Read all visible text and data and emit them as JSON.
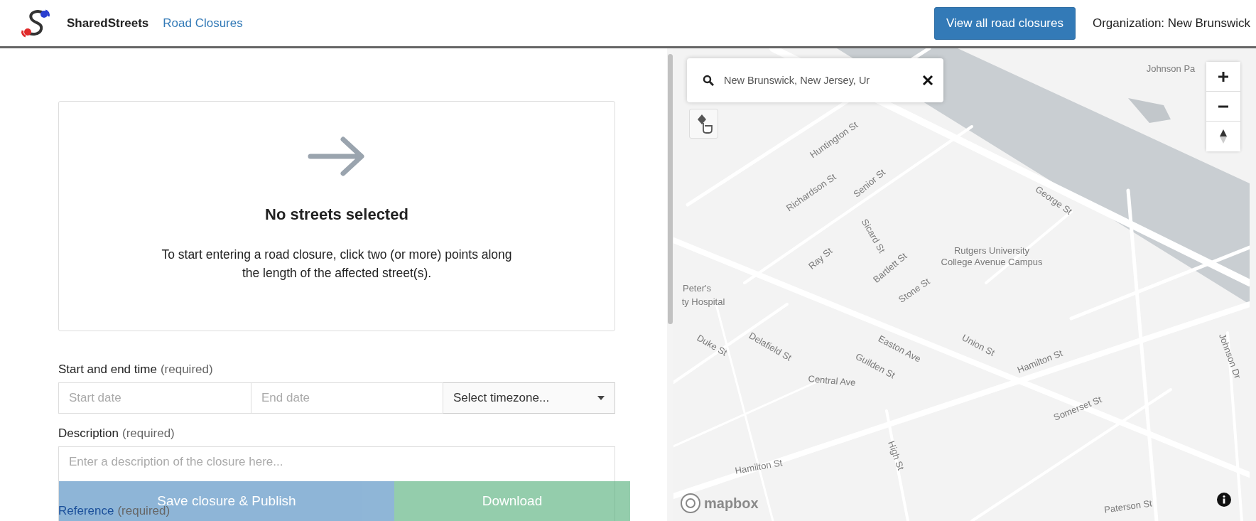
{
  "header": {
    "brand": "SharedStreets",
    "nav_link": "Road Closures",
    "view_all_button": "View all road closures",
    "organization": "Organization: New Brunswick"
  },
  "selection_card": {
    "title": "No streets selected",
    "message": "To start entering a road closure, click two (or more) points along the length of the affected street(s)."
  },
  "form": {
    "time": {
      "label": "Start and end time",
      "required_note": "(required)",
      "start_placeholder": "Start date",
      "end_placeholder": "End date",
      "timezone": "Select timezone..."
    },
    "description": {
      "label": "Description",
      "required_note": "(required)",
      "placeholder": "Enter a description of the closure here..."
    },
    "reference": {
      "label": "Reference",
      "required_note": "(required)"
    }
  },
  "actions": [
    {
      "kind": "publish",
      "label": "Save closure & Publish",
      "disabled": true
    },
    {
      "kind": "download",
      "label": "Download",
      "disabled": true
    }
  ],
  "map": {
    "search": {
      "value": "New Brunswick, New Jersey, Ur"
    },
    "labels": [
      {
        "text": "Huntington St"
      },
      {
        "text": "Richardson St"
      },
      {
        "text": "Senior St"
      },
      {
        "text": "Sicard St"
      },
      {
        "text": "Ray St"
      },
      {
        "text": "Bartlett St"
      },
      {
        "text": "Stone St"
      },
      {
        "text": "George St"
      },
      {
        "text": "Rutgers University College Avenue Campus"
      },
      {
        "text": "Johnson Pa"
      },
      {
        "text": "Peter's"
      },
      {
        "text": "ty Hospital"
      },
      {
        "text": "Duke St"
      },
      {
        "text": "Delafield St"
      },
      {
        "text": "Easton Ave"
      },
      {
        "text": "Guilden St"
      },
      {
        "text": "Central Ave"
      },
      {
        "text": "Union St"
      },
      {
        "text": "Hamilton St"
      },
      {
        "text": "Somerset St"
      },
      {
        "text": "Johnson Dr"
      },
      {
        "text": "High St"
      },
      {
        "text": "Hamilton St"
      },
      {
        "text": "Paterson St"
      }
    ],
    "attribution_logo": "mapbox"
  }
}
